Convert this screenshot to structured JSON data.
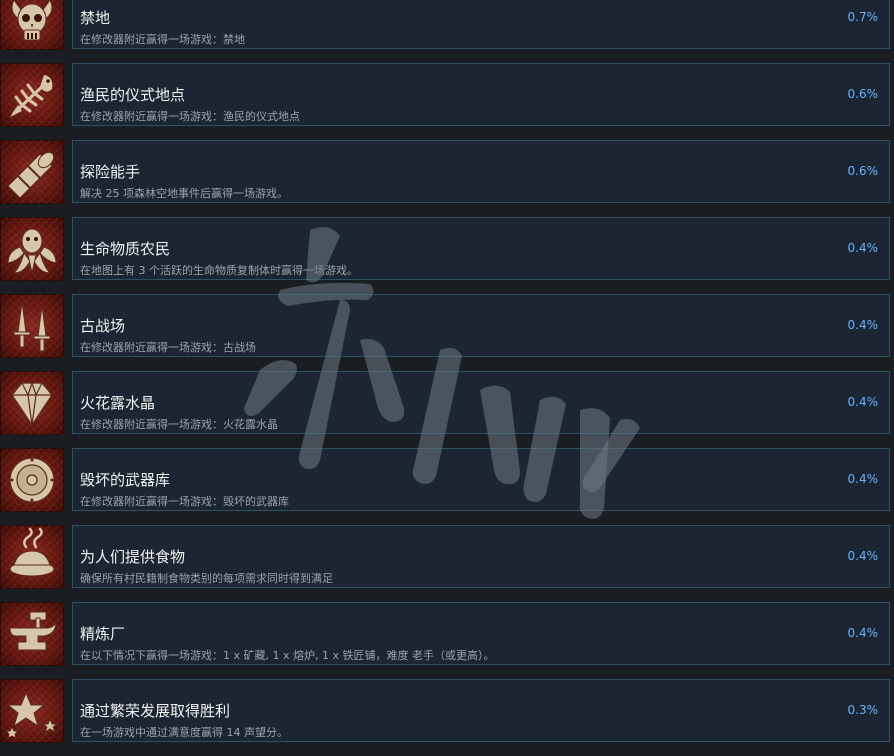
{
  "colors": {
    "background": "#1a1d21",
    "panel": "#1b2632",
    "panel_border": "#2d5163",
    "title": "#f2f2f2",
    "description": "#9aa3ab",
    "percentage": "#66b3ff",
    "icon_tile": "#7a1e14"
  },
  "achievements": [
    {
      "icon": "horned-skull-icon",
      "title": "禁地",
      "description": "在修改器附近赢得一场游戏：禁地",
      "percent": "0.7%"
    },
    {
      "icon": "fish-skeleton-icon",
      "title": "渔民的仪式地点",
      "description": "在修改器附近赢得一场游戏：渔民的仪式地点",
      "percent": "0.6%"
    },
    {
      "icon": "spyglass-icon",
      "title": "探险能手",
      "description": "解决 25 项森林空地事件后赢得一场游戏。",
      "percent": "0.6%"
    },
    {
      "icon": "biomass-creature-icon",
      "title": "生命物质农民",
      "description": "在地图上有 3 个活跃的生命物质复制体时赢得一场游戏。",
      "percent": "0.4%"
    },
    {
      "icon": "daggers-icon",
      "title": "古战场",
      "description": "在修改器附近赢得一场游戏：古战场",
      "percent": "0.4%"
    },
    {
      "icon": "crystal-diamond-icon",
      "title": "火花露水晶",
      "description": "在修改器附近赢得一场游戏：火花露水晶",
      "percent": "0.4%"
    },
    {
      "icon": "round-shield-icon",
      "title": "毁坏的武器库",
      "description": "在修改器附近赢得一场游戏：毁坏的武器库",
      "percent": "0.4%"
    },
    {
      "icon": "food-dish-icon",
      "title": "为人们提供食物",
      "description": "确保所有村民籍制食物类别的每项需求同时得到满足",
      "percent": "0.4%"
    },
    {
      "icon": "anvil-icon",
      "title": "精炼厂",
      "description": "在以下情况下赢得一场游戏：1 x 矿藏, 1 x 熔炉, 1 x 铁匠铺，难度 老手（或更高）。",
      "percent": "0.4%"
    },
    {
      "icon": "stars-icon",
      "title": "通过繁荣发展取得胜利",
      "description": "在一场游戏中通过满意度赢得 14 声望分。",
      "percent": "0.3%"
    }
  ]
}
